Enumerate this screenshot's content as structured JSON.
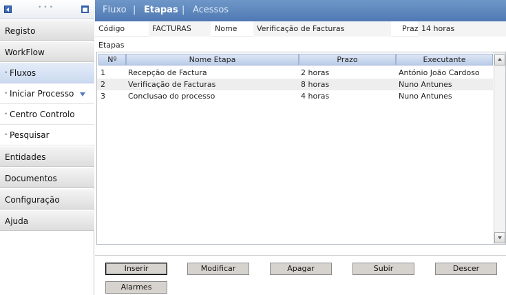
{
  "sidebar": {
    "items": [
      {
        "label": "Registo"
      },
      {
        "label": "WorkFlow"
      },
      {
        "label": "Fluxos",
        "active": true
      },
      {
        "label": "Iniciar Processo"
      },
      {
        "label": "Centro Controlo"
      },
      {
        "label": "Pesquisar"
      },
      {
        "label": "Entidades"
      },
      {
        "label": "Documentos"
      },
      {
        "label": "Configuração"
      },
      {
        "label": "Ajuda"
      }
    ]
  },
  "tabs": {
    "items": [
      {
        "label": "Fluxo"
      },
      {
        "label": "Etapas",
        "active": true
      },
      {
        "label": "Acessos"
      }
    ],
    "separator": "|"
  },
  "fields": {
    "codigo_label": "Código",
    "codigo_value": "FACTURAS",
    "nome_label": "Nome",
    "nome_value": "Verificação de Facturas",
    "prazo_label": "Prazo",
    "prazo_value": "14 horas"
  },
  "etapas": {
    "section_label": "Etapas",
    "columns": [
      "Nº",
      "Nome Etapa",
      "Prazo",
      "Executante"
    ],
    "rows": [
      [
        "1",
        "Recepção de Factura",
        "2 horas",
        "António João Cardoso"
      ],
      [
        "2",
        "Verificação de Facturas",
        "8 horas",
        "Nuno Antunes"
      ],
      [
        "3",
        "Conclusao do processo",
        "4 horas",
        "Nuno Antunes"
      ]
    ]
  },
  "buttons": {
    "inserir": "Inserir",
    "modificar": "Modificar",
    "apagar": "Apagar",
    "subir": "Subir",
    "descer": "Descer",
    "alarmes": "Alarmes"
  },
  "colors": {
    "tabbar": "#5f88be",
    "active_sidebar": "#cbdaf0",
    "grid_header": "#c8d7ee"
  }
}
